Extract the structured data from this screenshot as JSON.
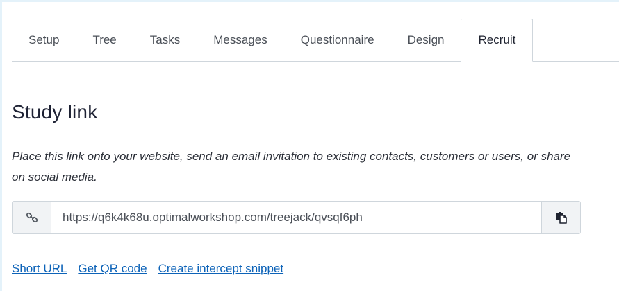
{
  "tabs": [
    {
      "label": "Setup"
    },
    {
      "label": "Tree"
    },
    {
      "label": "Tasks"
    },
    {
      "label": "Messages"
    },
    {
      "label": "Questionnaire"
    },
    {
      "label": "Design"
    },
    {
      "label": "Recruit",
      "active": true
    }
  ],
  "study_link": {
    "title": "Study link",
    "description": "Place this link onto your website, send an email invitation to existing contacts, customers or users, or share on social media.",
    "url": "https://q6k4k68u.optimalworkshop.com/treejack/qvsqf6ph",
    "link_icon": "link-icon",
    "copy_icon": "copy-icon"
  },
  "actions": {
    "short_url": "Short URL",
    "qr_code": "Get QR code",
    "intercept": "Create intercept snippet"
  },
  "colors": {
    "accent_link": "#0d63b8",
    "page_border": "#e4f2fa",
    "divider": "#cfd6dc"
  }
}
